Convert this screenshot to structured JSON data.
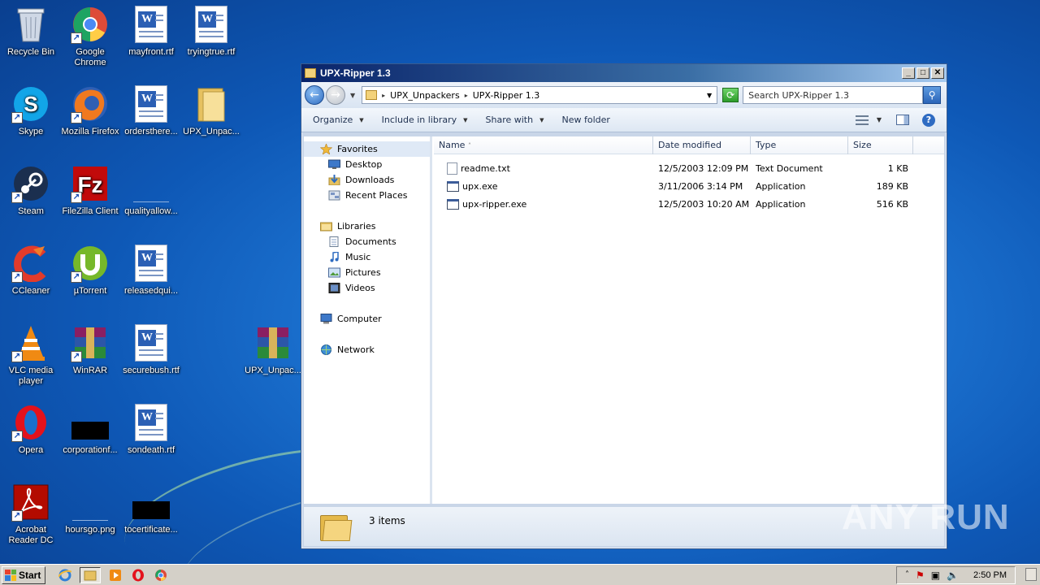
{
  "desktop": {
    "icons": [
      {
        "label": "Recycle Bin"
      },
      {
        "label": "Google Chrome"
      },
      {
        "label": "mayfront.rtf"
      },
      {
        "label": "tryingtrue.rtf"
      },
      {
        "label": "Skype"
      },
      {
        "label": "Mozilla Firefox"
      },
      {
        "label": "ordersthere..."
      },
      {
        "label": "UPX_Unpac..."
      },
      {
        "label": "Steam"
      },
      {
        "label": "FileZilla Client"
      },
      {
        "label": "qualityallow..."
      },
      {
        "label": "CCleaner"
      },
      {
        "label": "µTorrent"
      },
      {
        "label": "releasedqui..."
      },
      {
        "label": "VLC media player"
      },
      {
        "label": "WinRAR"
      },
      {
        "label": "securebush.rtf"
      },
      {
        "label": "UPX_Unpac..."
      },
      {
        "label": "Opera"
      },
      {
        "label": "corporationf..."
      },
      {
        "label": "sondeath.rtf"
      },
      {
        "label": "Acrobat Reader DC"
      },
      {
        "label": "hoursgo.png"
      },
      {
        "label": "tocertificate..."
      }
    ]
  },
  "window": {
    "title": "UPX-Ripper 1.3",
    "breadcrumb": [
      "UPX_Unpackers",
      "UPX-Ripper 1.3"
    ],
    "search_placeholder": "Search UPX-Ripper 1.3",
    "toolbar": {
      "organize": "Organize",
      "include_in_library": "Include in library",
      "share_with": "Share with",
      "new_folder": "New folder"
    },
    "nav": {
      "favorites": "Favorites",
      "desktop": "Desktop",
      "downloads": "Downloads",
      "recent_places": "Recent Places",
      "libraries": "Libraries",
      "documents": "Documents",
      "music": "Music",
      "pictures": "Pictures",
      "videos": "Videos",
      "computer": "Computer",
      "network": "Network"
    },
    "columns": {
      "name": "Name",
      "date_modified": "Date modified",
      "type": "Type",
      "size": "Size"
    },
    "files": [
      {
        "name": "readme.txt",
        "date": "12/5/2003 12:09 PM",
        "type": "Text Document",
        "size": "1 KB"
      },
      {
        "name": "upx.exe",
        "date": "3/11/2006 3:14 PM",
        "type": "Application",
        "size": "189 KB"
      },
      {
        "name": "upx-ripper.exe",
        "date": "12/5/2003 10:20 AM",
        "type": "Application",
        "size": "516 KB"
      }
    ],
    "status": "3 items"
  },
  "taskbar": {
    "start": "Start",
    "clock": "2:50 PM"
  },
  "watermark": "ANY RUN"
}
